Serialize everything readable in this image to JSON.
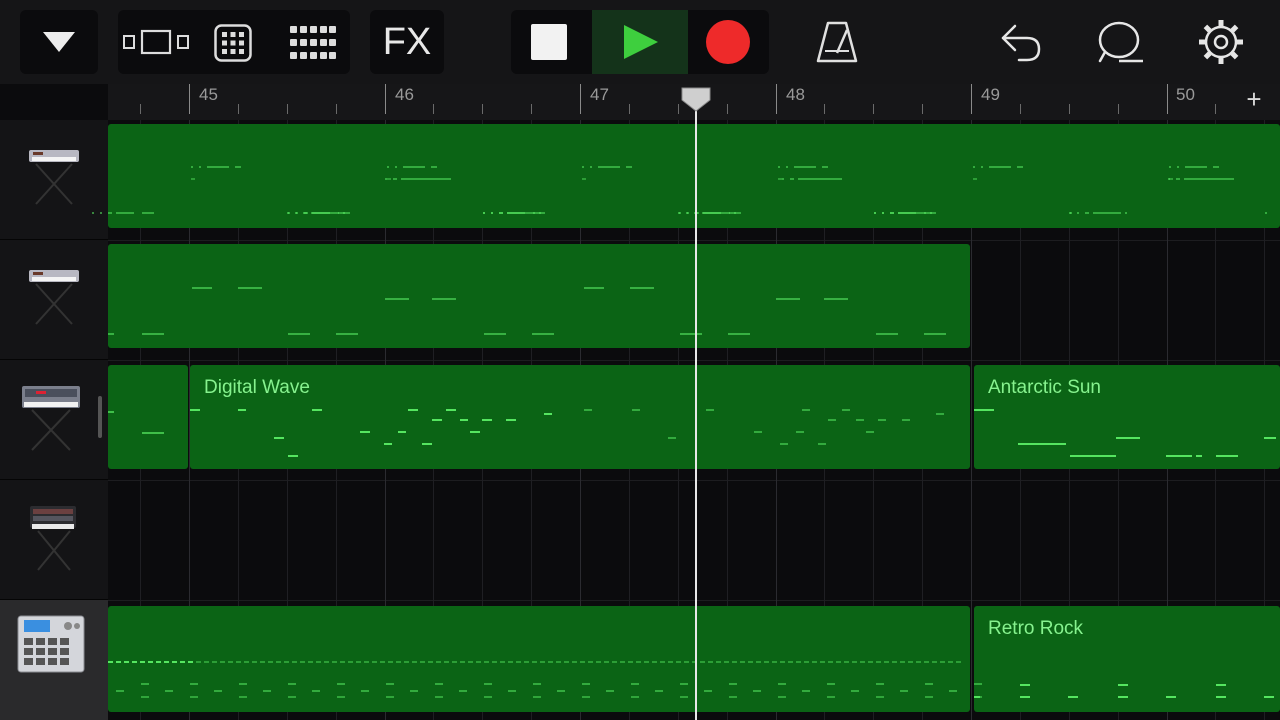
{
  "toolbar": {
    "fx_label": "FX",
    "icons": {
      "tracks_menu": "dropdown-triangle-icon",
      "view": "tracks-view-icon",
      "instrument": "grid-pad-icon",
      "live_loops": "live-loops-grid-icon",
      "stop": "stop-icon",
      "play": "play-icon",
      "record": "record-icon",
      "metronome": "metronome-icon",
      "undo": "undo-icon",
      "loop_browser": "loop-browser-icon",
      "settings": "settings-gear-icon"
    },
    "colors": {
      "play": "#3ecf3e",
      "record": "#ee2a2a",
      "region": "#0b6415",
      "notes": "#55e560",
      "region_label": "#86f28e"
    }
  },
  "ruler": {
    "bars": [
      "45",
      "46",
      "47",
      "48",
      "49",
      "50"
    ],
    "add_label": "+"
  },
  "tracks": [
    {
      "instrument_icon": "keyboard-synth-icon",
      "region_labels": []
    },
    {
      "instrument_icon": "keyboard-synth-icon",
      "region_labels": []
    },
    {
      "instrument_icon": "analog-synth-icon",
      "region_labels": [
        "Digital Wave",
        "Antarctic Sun"
      ]
    },
    {
      "instrument_icon": "modular-synth-icon",
      "region_labels": []
    },
    {
      "instrument_icon": "drum-machine-icon",
      "region_labels": [
        "Retro Rock"
      ]
    }
  ]
}
